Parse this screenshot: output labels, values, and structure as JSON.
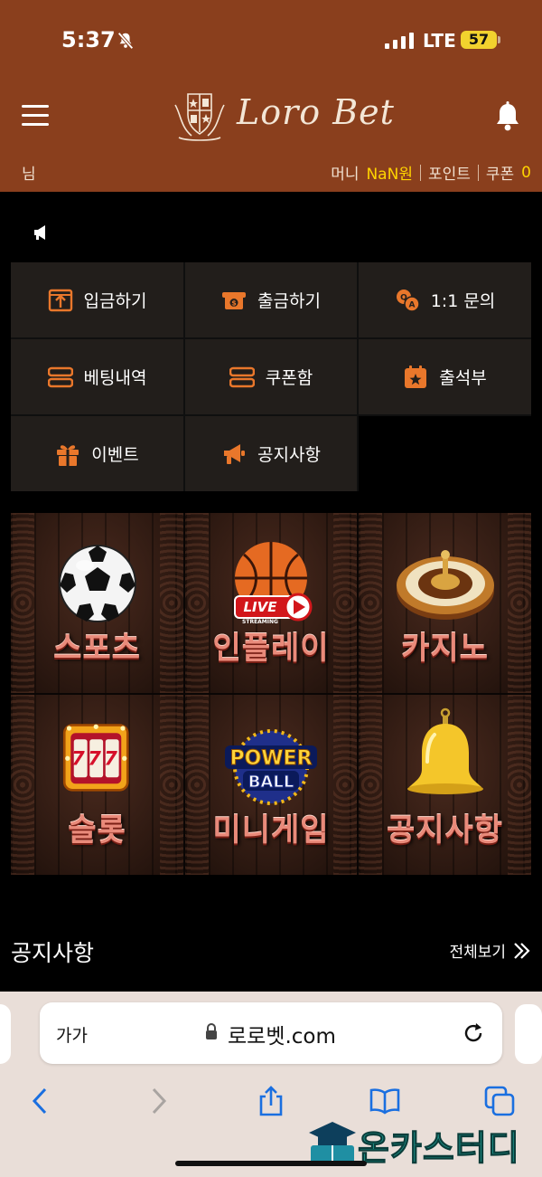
{
  "status_bar": {
    "time": "5:37",
    "network": "LTE",
    "battery": "57"
  },
  "header": {
    "logo_text": "Loro Bet",
    "user_suffix": "님",
    "money_label": "머니",
    "money_value": "NaN원",
    "points_label": "포인트",
    "coupon_label": "쿠폰",
    "coupon_value": "0"
  },
  "menu": [
    {
      "label": "입금하기",
      "icon": "deposit-icon"
    },
    {
      "label": "출금하기",
      "icon": "withdraw-icon"
    },
    {
      "label": "1:1 문의",
      "icon": "qa-icon"
    },
    {
      "label": "베팅내역",
      "icon": "betting-history-icon"
    },
    {
      "label": "쿠폰함",
      "icon": "coupon-box-icon"
    },
    {
      "label": "출석부",
      "icon": "attendance-icon"
    },
    {
      "label": "이벤트",
      "icon": "gift-icon"
    },
    {
      "label": "공지사항",
      "icon": "megaphone-icon"
    }
  ],
  "games": [
    {
      "label": "스포츠",
      "icon": "soccer-ball-icon"
    },
    {
      "label": "인플레이",
      "icon": "basketball-live-icon",
      "badge": "LIVE",
      "badge_sub": "STREAMING"
    },
    {
      "label": "카지노",
      "icon": "roulette-icon"
    },
    {
      "label": "슬롯",
      "icon": "slot-machine-icon",
      "reel_text": "777"
    },
    {
      "label": "미니게임",
      "icon": "powerball-icon",
      "top": "POWER",
      "bottom": "BALL"
    },
    {
      "label": "공지사항",
      "icon": "golden-bell-icon"
    }
  ],
  "notice": {
    "title": "공지사항",
    "view_all": "전체보기"
  },
  "browser": {
    "text_size": "가가",
    "url": "로로벳.com"
  },
  "watermark": "온카스터디",
  "colors": {
    "header_bg": "#8a3f1d",
    "accent_orange": "#e9772b",
    "gold": "#ffd400",
    "menu_bg": "#221e1b"
  }
}
